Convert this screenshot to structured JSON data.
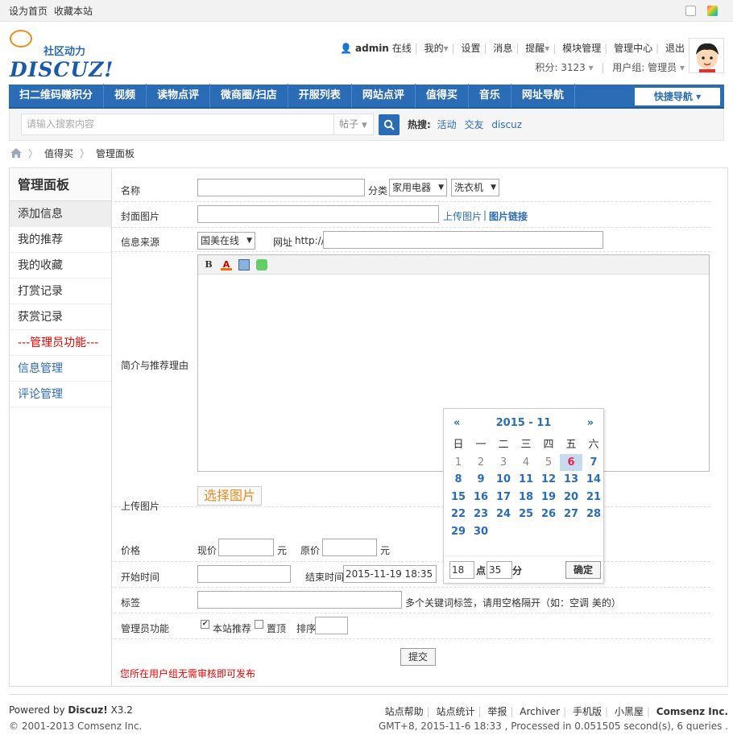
{
  "topbar": {
    "set_home": "设为首页",
    "bookmark": "收藏本站"
  },
  "logo": {
    "cn": "社区动力",
    "en": "DISCUZ!"
  },
  "user": {
    "name": "admin",
    "online": "在线",
    "menu": [
      "我的",
      "设置",
      "消息",
      "提醒",
      "模块管理",
      "管理中心",
      "退出"
    ],
    "points_label": "积分: 3123",
    "group_label": "用户组: 管理员"
  },
  "nav": {
    "items": [
      "扫二维码赚积分",
      "视频",
      "读物点评",
      "微商圈/扫店",
      "开服列表",
      "网站点评",
      "值得买",
      "音乐",
      "网址导航"
    ],
    "quick": "快捷导航 ▾"
  },
  "search": {
    "placeholder": "请输入搜索内容",
    "type": "帖子",
    "hot_label": "热搜:",
    "hot": [
      "活动",
      "交友",
      "discuz"
    ]
  },
  "crumb": [
    "值得买",
    "管理面板"
  ],
  "side": {
    "title": "管理面板",
    "items": [
      "添加信息",
      "我的推荐",
      "我的收藏",
      "打赏记录",
      "获赏记录"
    ],
    "admin_label": "---管理员功能---",
    "admin_items": [
      "信息管理",
      "评论管理"
    ]
  },
  "form": {
    "name_label": "名称",
    "category_label": "分类",
    "category1": "家用电器",
    "category2": "洗衣机",
    "cover_label": "封面图片",
    "upload_link": "上传图片",
    "image_link": "图片链接",
    "source_label": "信息来源",
    "source_value": "国美在线",
    "url_label": "网址",
    "url_prefix": "http://",
    "intro_label": "简介与推荐理由",
    "upload_label": "上传图片",
    "choose_image": "选择图片",
    "price_label": "价格",
    "current_price": "现价",
    "original_price": "原价",
    "yuan": "元",
    "start_label": "开始时间",
    "end_label": "结束时间",
    "end_value": "2015-11-19 18:35",
    "tag_label": "标签",
    "tag_hint": "多个关键词标签，请用空格隔开（如：空调 美的）",
    "admin_label": "管理员功能",
    "recommend": "本站推荐",
    "top": "置顶",
    "order": "排序",
    "submit": "提交",
    "note": "您所在用户组无需审核即可发布"
  },
  "calendar": {
    "prev": "«",
    "next": "»",
    "title": "2015 - 11",
    "weekdays": [
      "日",
      "一",
      "二",
      "三",
      "四",
      "五",
      "六"
    ],
    "prev_days": [
      "1",
      "2",
      "3",
      "4",
      "5"
    ],
    "today": "6",
    "days": [
      "7",
      "8",
      "9",
      "10",
      "11",
      "12",
      "13",
      "14",
      "15",
      "16",
      "17",
      "18",
      "19",
      "20",
      "21",
      "22",
      "23",
      "24",
      "25",
      "26",
      "27",
      "28",
      "29",
      "30"
    ],
    "hour": "18",
    "hour_label": "点",
    "minute": "35",
    "minute_label": "分",
    "confirm": "确定"
  },
  "footer": {
    "powered": "Powered by",
    "brand": "Discuz!",
    "version": "X3.2",
    "copyright": "© 2001-2013 Comsenz Inc.",
    "links": [
      "站点帮助",
      "站点统计",
      "举报",
      "Archiver",
      "手机版",
      "小黑屋"
    ],
    "company": "Comsenz Inc.",
    "stats": "GMT+8, 2015-11-6 18:33 , Processed in 0.051505 second(s), 6 queries ."
  }
}
